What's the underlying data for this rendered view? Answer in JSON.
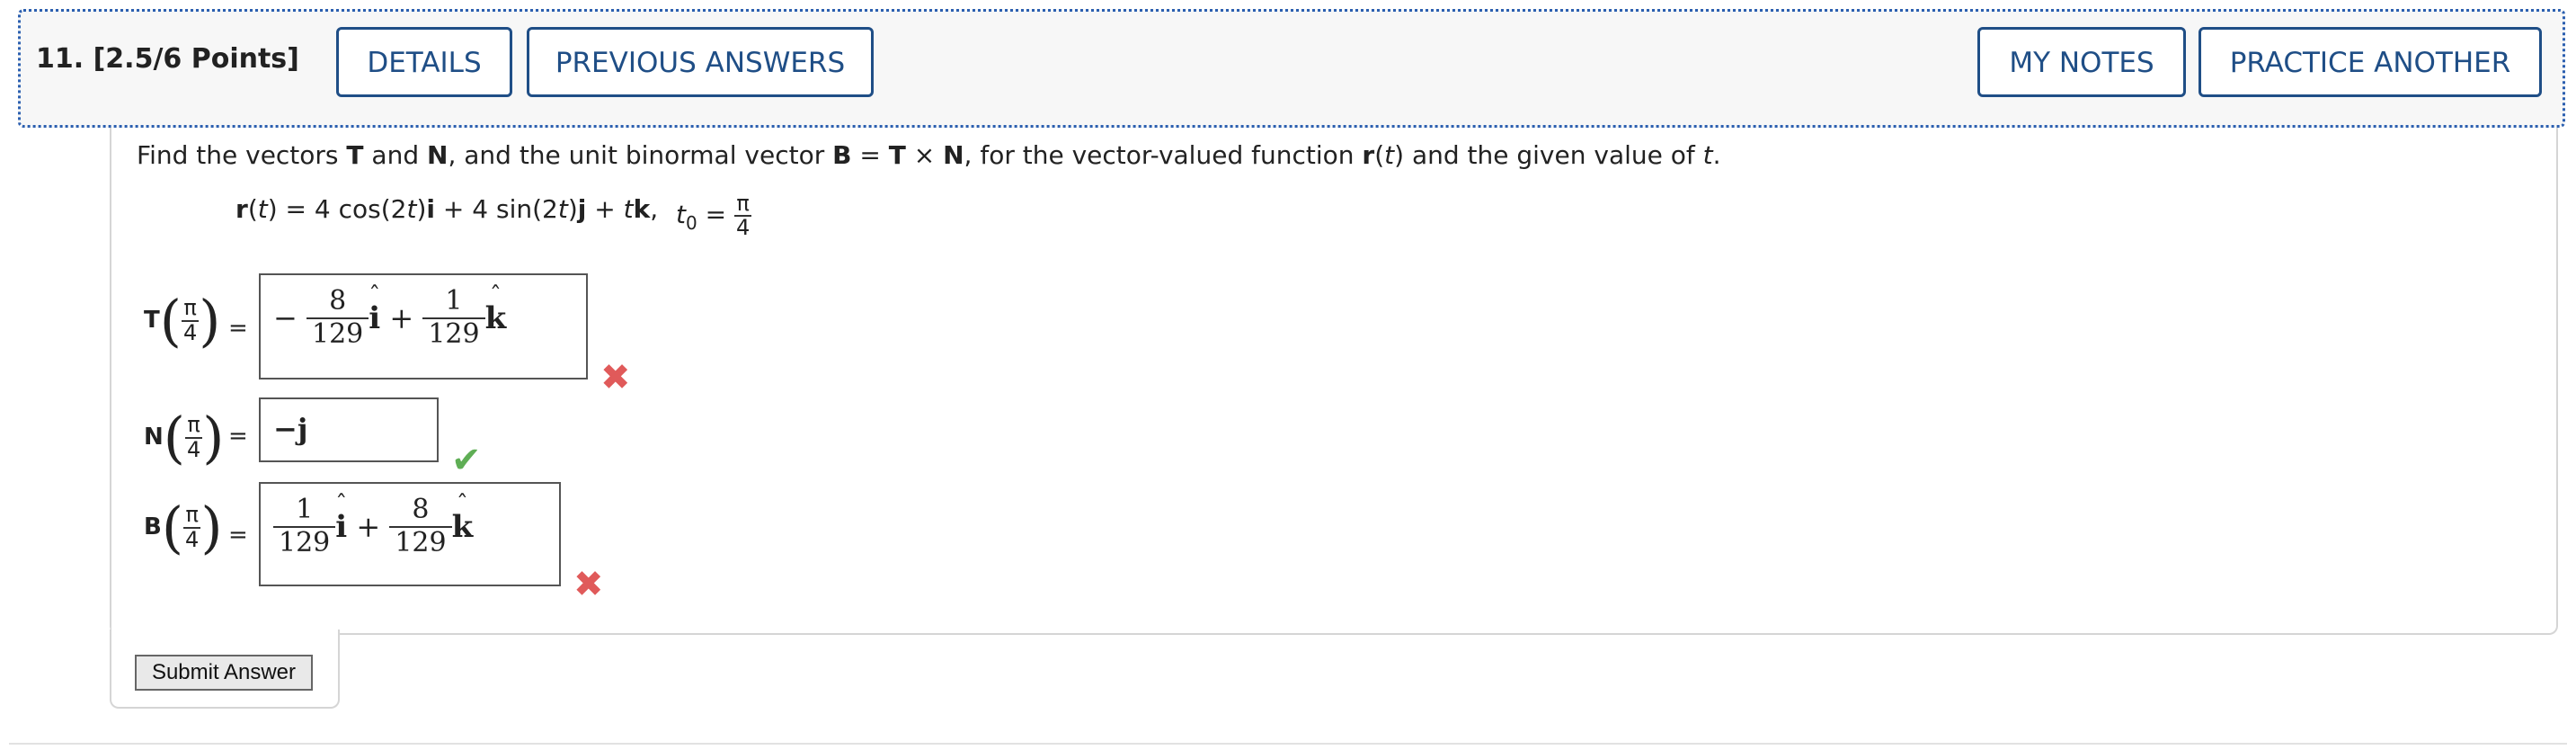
{
  "header": {
    "question_label": "11.  [2.5/6 Points]",
    "buttons": {
      "details": "DETAILS",
      "previous_answers": "PREVIOUS ANSWERS",
      "my_notes": "MY NOTES",
      "practice_another": "PRACTICE ANOTHER"
    }
  },
  "prompt": {
    "p1": "Find the vectors ",
    "T": "T",
    "and1": " and ",
    "N": "N",
    "p2": ", and the unit binormal vector ",
    "B": "B",
    "eq": " = ",
    "T2": "T",
    "cross": " × ",
    "N2": "N",
    "p3": ", for the vector-valued function ",
    "r": "r",
    "p4": "(",
    "t": "t",
    "p5": ") and the given value of ",
    "t2": "t",
    "p6": "."
  },
  "function": {
    "r": "r",
    "open": "(",
    "t": "t",
    "mid1": ") = 4 cos(2",
    "t2": "t",
    "mid2": ")",
    "i": "i",
    "mid3": " + 4 sin(2",
    "t3": "t",
    "mid4": ")",
    "j": "j",
    "mid5": " + ",
    "t4": "t",
    "k": "k",
    "end": ",",
    "t0_label": "t",
    "t0_sub": "0",
    "t0_eq": " = ",
    "t0_num": "π",
    "t0_den": "4"
  },
  "vectors": {
    "T": {
      "label": "T",
      "arg_num": "π",
      "arg_den": "4",
      "eq": "=",
      "answer": {
        "sign1": "−",
        "f1_num": "8",
        "f1_den": "129",
        "u1": "i",
        "hat": "ˆ",
        "plus": "+",
        "f2_num": "1",
        "f2_den": "129",
        "u2": "k"
      },
      "status": "incorrect",
      "mark": "✖"
    },
    "N": {
      "label": "N",
      "arg_num": "π",
      "arg_den": "4",
      "eq": "=",
      "answer": {
        "text": "−j"
      },
      "status": "correct",
      "mark": "✔"
    },
    "B": {
      "label": "B",
      "arg_num": "π",
      "arg_den": "4",
      "eq": "=",
      "answer": {
        "f1_num": "1",
        "f1_den": "129",
        "u1": "i",
        "hat": "ˆ",
        "plus": "+",
        "f2_num": "8",
        "f2_den": "129",
        "u2": "k"
      },
      "status": "incorrect",
      "mark": "✖"
    }
  },
  "submit_label": "Submit Answer",
  "colors": {
    "accent": "#1f4e86",
    "header_border": "#2b5fb0",
    "incorrect": "#e05a5a",
    "correct": "#5fae55"
  }
}
